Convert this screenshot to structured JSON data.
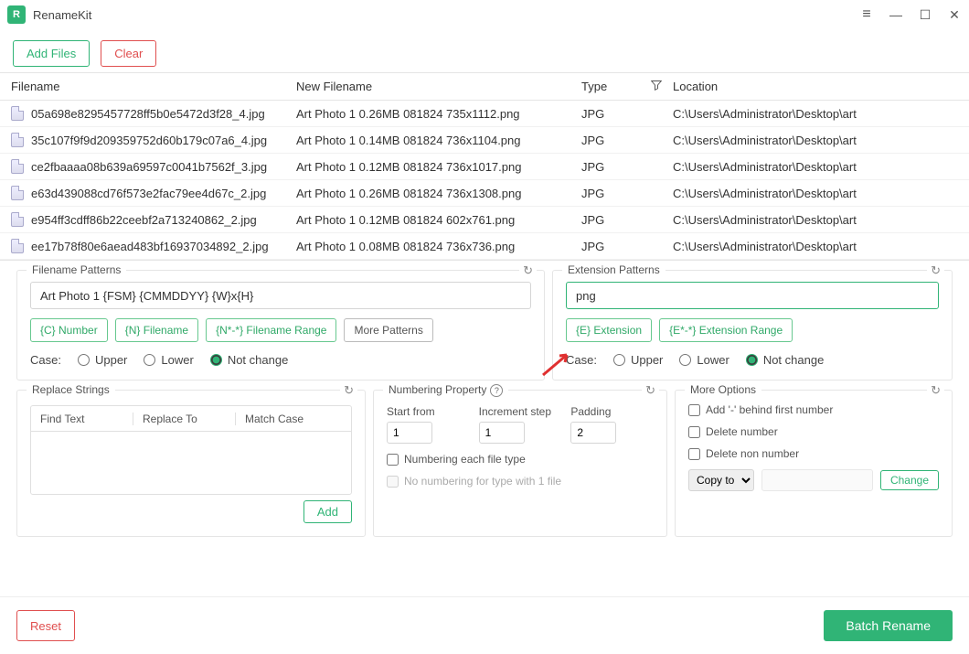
{
  "app": {
    "title": "RenameKit"
  },
  "toolbar": {
    "add_files": "Add Files",
    "clear": "Clear"
  },
  "table": {
    "headers": {
      "filename": "Filename",
      "new_filename": "New Filename",
      "type": "Type",
      "location": "Location"
    },
    "rows": [
      {
        "fn": "05a698e8295457728ff5b0e5472d3f28_4.jpg",
        "nfn": "Art Photo 1 0.26MB 081824 735x1112.png",
        "type": "JPG",
        "loc": "C:\\Users\\Administrator\\Desktop\\art"
      },
      {
        "fn": "35c107f9f9d209359752d60b179c07a6_4.jpg",
        "nfn": "Art Photo 1 0.14MB 081824 736x1104.png",
        "type": "JPG",
        "loc": "C:\\Users\\Administrator\\Desktop\\art"
      },
      {
        "fn": "ce2fbaaaa08b639a69597c0041b7562f_3.jpg",
        "nfn": "Art Photo 1 0.12MB 081824 736x1017.png",
        "type": "JPG",
        "loc": "C:\\Users\\Administrator\\Desktop\\art"
      },
      {
        "fn": "e63d439088cd76f573e2fac79ee4d67c_2.jpg",
        "nfn": "Art Photo 1 0.26MB 081824 736x1308.png",
        "type": "JPG",
        "loc": "C:\\Users\\Administrator\\Desktop\\art"
      },
      {
        "fn": "e954ff3cdff86b22ceebf2a713240862_2.jpg",
        "nfn": "Art Photo 1 0.12MB 081824 602x761.png",
        "type": "JPG",
        "loc": "C:\\Users\\Administrator\\Desktop\\art"
      },
      {
        "fn": "ee17b78f80e6aead483bf16937034892_2.jpg",
        "nfn": "Art Photo 1 0.08MB 081824 736x736.png",
        "type": "JPG",
        "loc": "C:\\Users\\Administrator\\Desktop\\art"
      }
    ]
  },
  "filename_patterns": {
    "title": "Filename Patterns",
    "value": "Art Photo 1 {FSM} {CMMDDYY} {W}x{H}",
    "tags": {
      "c_number": "{C} Number",
      "n_filename": "{N} Filename",
      "n_range": "{N*-*} Filename Range",
      "more": "More Patterns"
    },
    "case_label": "Case:",
    "upper": "Upper",
    "lower": "Lower",
    "not_change": "Not change"
  },
  "extension_patterns": {
    "title": "Extension Patterns",
    "value": "png",
    "tags": {
      "e_ext": "{E} Extension",
      "e_range": "{E*-*} Extension Range"
    },
    "case_label": "Case:",
    "upper": "Upper",
    "lower": "Lower",
    "not_change": "Not change"
  },
  "replace_strings": {
    "title": "Replace Strings",
    "headers": {
      "find": "Find Text",
      "replace": "Replace To",
      "match": "Match Case"
    },
    "add": "Add"
  },
  "numbering": {
    "title": "Numbering Property",
    "start_label": "Start from",
    "start": "1",
    "step_label": "Increment step",
    "step": "1",
    "pad_label": "Padding",
    "pad": "2",
    "each_type": "Numbering each file type",
    "no_one": "No numbering for type with 1 file"
  },
  "more_options": {
    "title": "More Options",
    "add_dash": "Add '-' behind first number",
    "delete_num": "Delete number",
    "delete_non_num": "Delete non number",
    "copy_to": "Copy to",
    "change": "Change"
  },
  "footer": {
    "reset": "Reset",
    "batch": "Batch Rename"
  }
}
